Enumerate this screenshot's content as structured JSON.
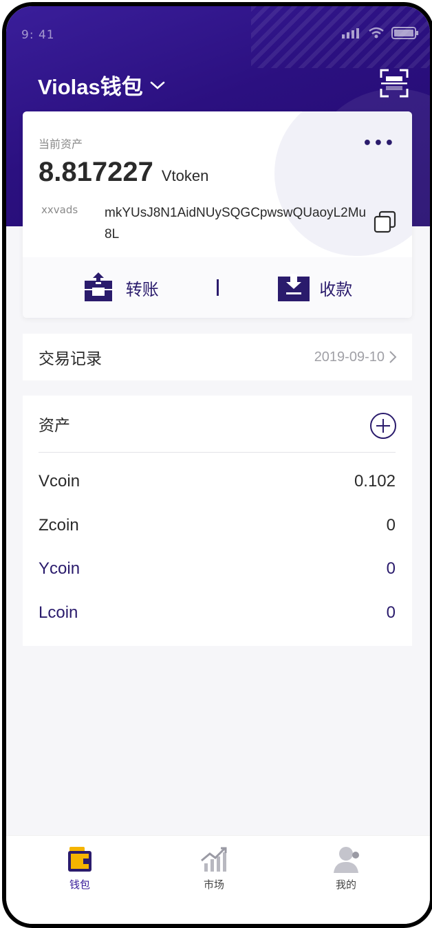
{
  "status_bar": {
    "time": "9: 41"
  },
  "header": {
    "title": "Violas钱包"
  },
  "wallet_card": {
    "asset_label": "当前资产",
    "amount": "8.817227",
    "unit": "Vtoken",
    "account_name": "xxvads",
    "address": "mkYUsJ8N1AidNUySQGCpwswQUaoyL2Mu8L",
    "transfer_label": "转账",
    "receive_label": "收款"
  },
  "transactions": {
    "label": "交易记录",
    "date": "2019-09-10"
  },
  "assets": {
    "title": "资产",
    "items": [
      {
        "name": "Vcoin",
        "value": "0.102"
      },
      {
        "name": "Zcoin",
        "value": "0"
      },
      {
        "name": "Ycoin",
        "value": "0"
      },
      {
        "name": "Lcoin",
        "value": "0"
      }
    ]
  },
  "tabbar": {
    "tabs": [
      {
        "label": "钱包",
        "icon": "wallet-icon"
      },
      {
        "label": "市场",
        "icon": "market-chart-icon"
      },
      {
        "label": "我的",
        "icon": "profile-icon"
      }
    ]
  },
  "colors": {
    "brand_purple": "#2a1b6c",
    "header_purple": "#2b1080",
    "accent_yellow": "#f5b400"
  }
}
